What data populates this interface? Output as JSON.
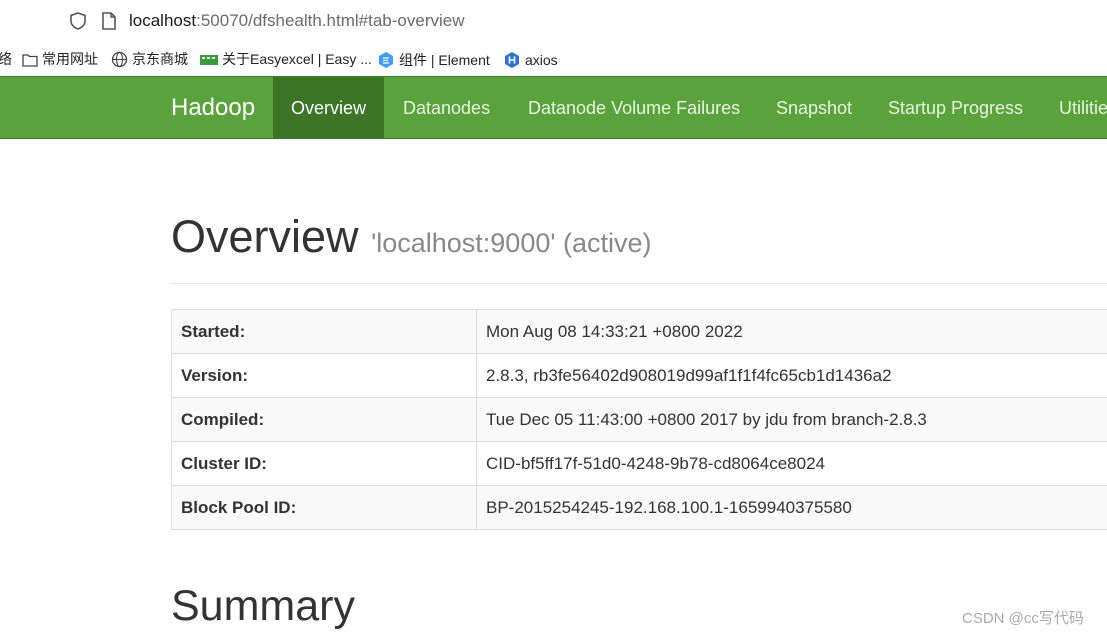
{
  "browser": {
    "url_host": "localhost",
    "url_rest": ":50070/dfshealth.html#tab-overview",
    "bookmarks": [
      {
        "label": "络",
        "icon": "none"
      },
      {
        "label": "常用网址",
        "icon": "folder-icon"
      },
      {
        "label": "京东商城",
        "icon": "globe-icon"
      },
      {
        "label": "关于Easyexcel | Easy ...",
        "icon": "easyexcel-icon"
      },
      {
        "label": "组件 | Element",
        "icon": "element-icon"
      },
      {
        "label": "axios",
        "icon": "axios-icon"
      }
    ]
  },
  "navbar": {
    "brand": "Hadoop",
    "items": [
      {
        "label": "Overview",
        "active": true
      },
      {
        "label": "Datanodes"
      },
      {
        "label": "Datanode Volume Failures"
      },
      {
        "label": "Snapshot"
      },
      {
        "label": "Startup Progress"
      },
      {
        "label": "Utilitie"
      }
    ]
  },
  "overview": {
    "heading": "Overview",
    "subheading": "'localhost:9000' (active)",
    "rows": [
      {
        "key": "Started:",
        "value": "Mon Aug 08 14:33:21 +0800 2022"
      },
      {
        "key": "Version:",
        "value": "2.8.3, rb3fe56402d908019d99af1f1f4fc65cb1d1436a2"
      },
      {
        "key": "Compiled:",
        "value": "Tue Dec 05 11:43:00 +0800 2017 by jdu from branch-2.8.3"
      },
      {
        "key": "Cluster ID:",
        "value": "CID-bf5ff17f-51d0-4248-9b78-cd8064ce8024"
      },
      {
        "key": "Block Pool ID:",
        "value": "BP-2015254245-192.168.100.1-1659940375580"
      }
    ]
  },
  "summary": {
    "heading": "Summary"
  },
  "watermark": "CSDN @cc写代码",
  "colors": {
    "navbar": "#5aa23c",
    "navbar_active": "#3c7428"
  }
}
